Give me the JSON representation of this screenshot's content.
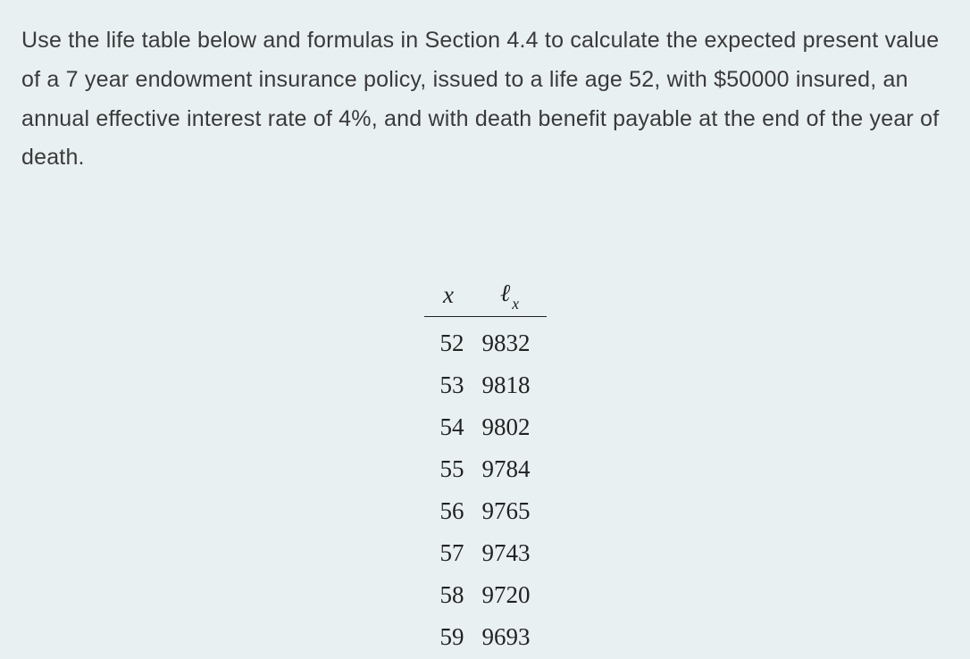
{
  "question": {
    "text": "Use the life table below and formulas in Section 4.4 to calculate the expected present value of a 7 year endowment insurance policy, issued to a life age 52, with $50000 insured, an annual effective interest rate of 4%, and with death benefit payable at the end of the year of death."
  },
  "table": {
    "headers": {
      "x": "x",
      "lx_script": "ℓ",
      "lx_sub": "x"
    },
    "rows": [
      {
        "x": "52",
        "lx": "9832"
      },
      {
        "x": "53",
        "lx": "9818"
      },
      {
        "x": "54",
        "lx": "9802"
      },
      {
        "x": "55",
        "lx": "9784"
      },
      {
        "x": "56",
        "lx": "9765"
      },
      {
        "x": "57",
        "lx": "9743"
      },
      {
        "x": "58",
        "lx": "9720"
      },
      {
        "x": "59",
        "lx": "9693"
      }
    ]
  }
}
